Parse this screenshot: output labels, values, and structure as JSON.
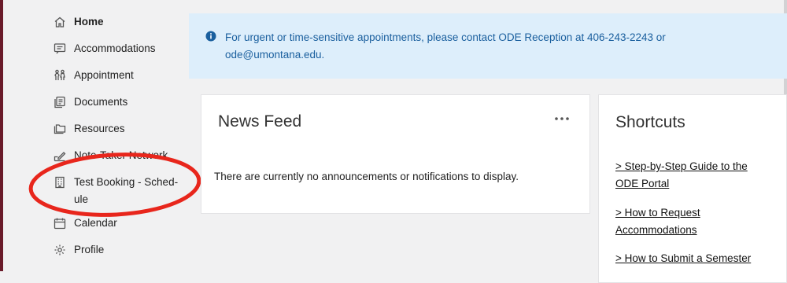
{
  "sidebar": {
    "items": [
      {
        "label": "Home",
        "icon": "home-icon"
      },
      {
        "label": "Accommodations",
        "icon": "chat-icon"
      },
      {
        "label": "Appointment",
        "icon": "people-icon"
      },
      {
        "label": "Documents",
        "icon": "documents-icon"
      },
      {
        "label": "Resources",
        "icon": "folder-icon"
      },
      {
        "label": "Note-Taker Network",
        "icon": "pen-icon"
      },
      {
        "label": "Test Booking - Sched-ule",
        "icon": "building-icon"
      },
      {
        "label": "Calendar",
        "icon": "calendar-icon"
      },
      {
        "label": "Profile",
        "icon": "gear-icon"
      }
    ]
  },
  "alert": {
    "text": "For urgent or time-sensitive appointments, please contact ODE Reception at 406-243-2243 or ode@umontana.edu.",
    "icon": "info-icon",
    "color": "#1a5f9e"
  },
  "news_feed": {
    "title": "News Feed",
    "empty_message": "There are currently no announcements or notifications to display.",
    "menu_icon": "more-horizontal-icon"
  },
  "shortcuts": {
    "title": "Shortcuts",
    "links": [
      "> Step-by-Step Guide to the ODE Portal",
      "> How to Request Accommodations",
      "> How to Submit a Semester"
    ]
  },
  "colors": {
    "accent_rail": "#6a1b2a",
    "annotation": "#e8261c",
    "alert_background": "#ddeefb"
  }
}
